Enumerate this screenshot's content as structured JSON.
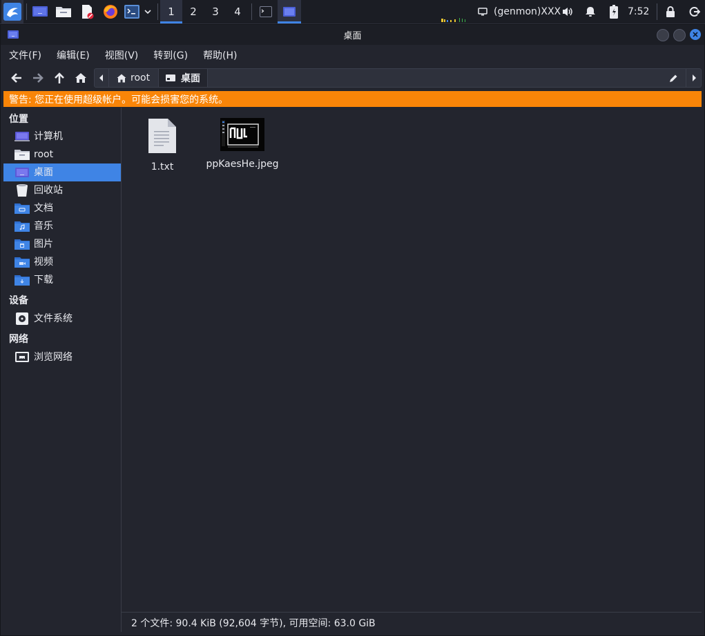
{
  "taskbar": {
    "workspaces": [
      "1",
      "2",
      "3",
      "4"
    ],
    "active_workspace": "1",
    "genmon": "(genmon)XXX",
    "clock": "7:52"
  },
  "window": {
    "title": "桌面"
  },
  "menu": {
    "file": "文件(F)",
    "edit": "编辑(E)",
    "view": "视图(V)",
    "go": "转到(G)",
    "help": "帮助(H)"
  },
  "path": {
    "crumbs": [
      "root",
      "桌面"
    ]
  },
  "warning": "警告: 您正在使用超级帐户。可能会损害您的系统。",
  "sidebar": {
    "places_header": "位置",
    "places": [
      "计算机",
      "root",
      "桌面",
      "回收站",
      "文档",
      "音乐",
      "图片",
      "视频",
      "下载"
    ],
    "selected": "桌面",
    "devices_header": "设备",
    "devices": [
      "文件系统"
    ],
    "network_header": "网络",
    "network": [
      "浏览网络"
    ]
  },
  "files": [
    {
      "name": "1.txt",
      "icon": "text-file-icon"
    },
    {
      "name": "ppKaesHe.jpeg",
      "icon": "image-thumbnail"
    }
  ],
  "status": "2 个文件: 90.4 KiB (92,604 字节), 可用空间: 63.0 GiB",
  "colors": {
    "accent": "#3f84e5",
    "warning_bg": "#f98508",
    "background": "#23252e"
  }
}
